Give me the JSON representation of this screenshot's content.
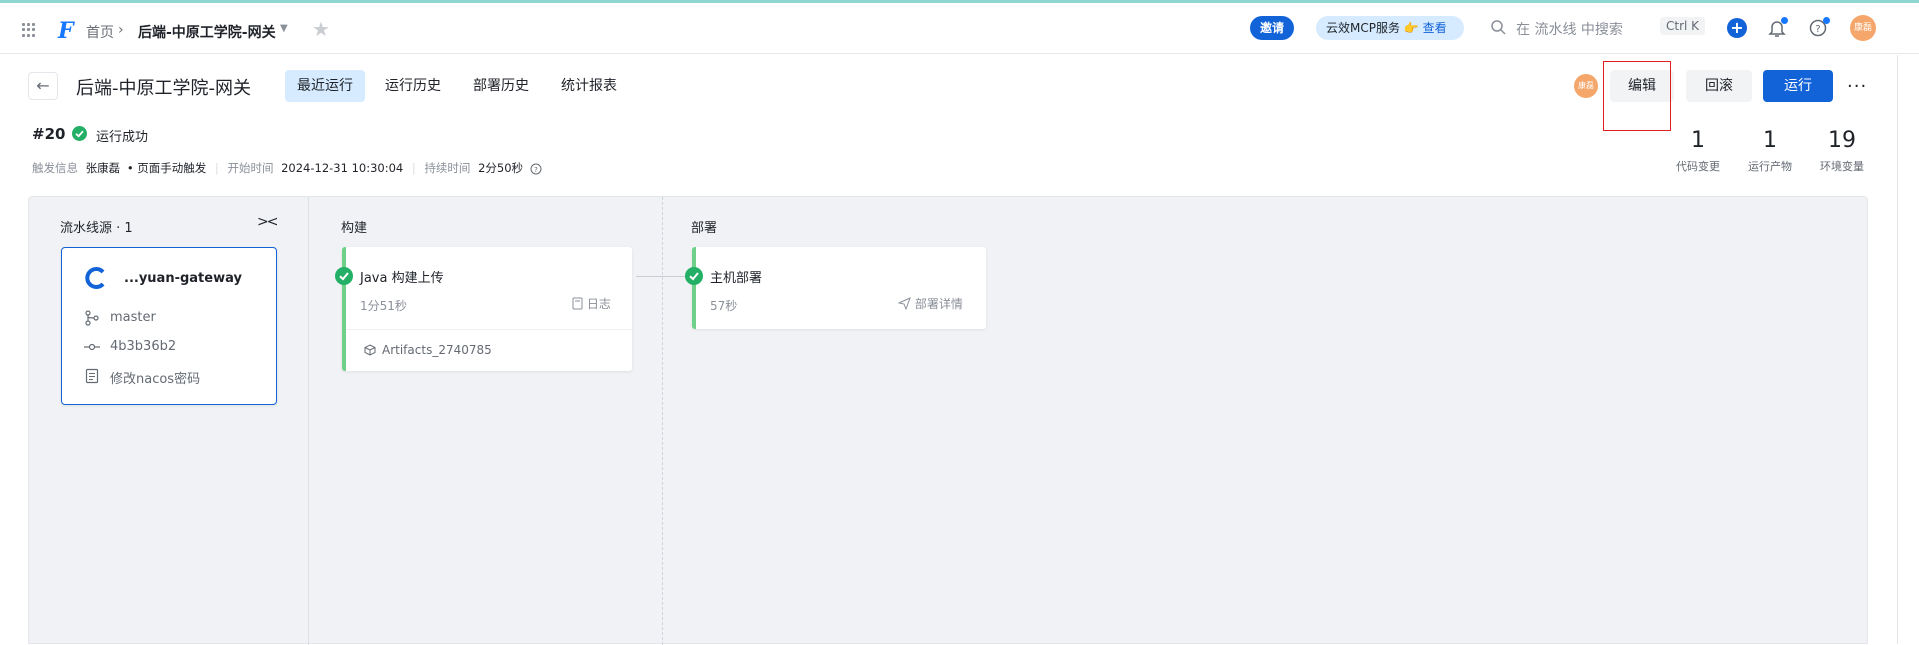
{
  "topnav": {
    "home": "首页",
    "project": "后端-中原工学院-网关",
    "invite": "邀请",
    "mcp_label": "云效MCP服务",
    "mcp_emoji": "👉",
    "mcp_link": "查看",
    "search_placeholder": "在 流水线 中搜索",
    "shortcut": "Ctrl K",
    "user_avatar": "康磊"
  },
  "header": {
    "title": "后端-中原工学院-网关",
    "tabs": [
      "最近运行",
      "运行历史",
      "部署历史",
      "统计报表"
    ],
    "active_tab": 0,
    "owner_avatar": "康磊",
    "edit_label": "编辑",
    "rollback_label": "回滚",
    "run_label": "运行"
  },
  "run": {
    "number": "#20",
    "status": "运行成功",
    "trigger_label": "触发信息",
    "trigger_user": "张康磊",
    "trigger_method": "• 页面手动触发",
    "start_label": "开始时间",
    "start_time": "2024-12-31 10:30:04",
    "duration_label": "持续时间",
    "duration": "2分50秒"
  },
  "stats": [
    {
      "value": "1",
      "label": "代码变更"
    },
    {
      "value": "1",
      "label": "运行产物"
    },
    {
      "value": "19",
      "label": "环境变量"
    }
  ],
  "pipeline": {
    "source_header": "流水线源 · 1",
    "source": {
      "repo": "...yuan-gateway",
      "branch": "master",
      "commit": "4b3b36b2",
      "message": "修改nacos密码"
    },
    "build_header": "构建",
    "build_job": {
      "name": "Java 构建上传",
      "duration": "1分51秒",
      "log_label": "日志",
      "artifact": "Artifacts_2740785"
    },
    "deploy_header": "部署",
    "deploy_job": {
      "name": "主机部署",
      "duration": "57秒",
      "detail_label": "部署详情"
    }
  },
  "colors": {
    "accent": "#1262d8",
    "success": "#23b066",
    "highlight_box": "#e02020"
  }
}
